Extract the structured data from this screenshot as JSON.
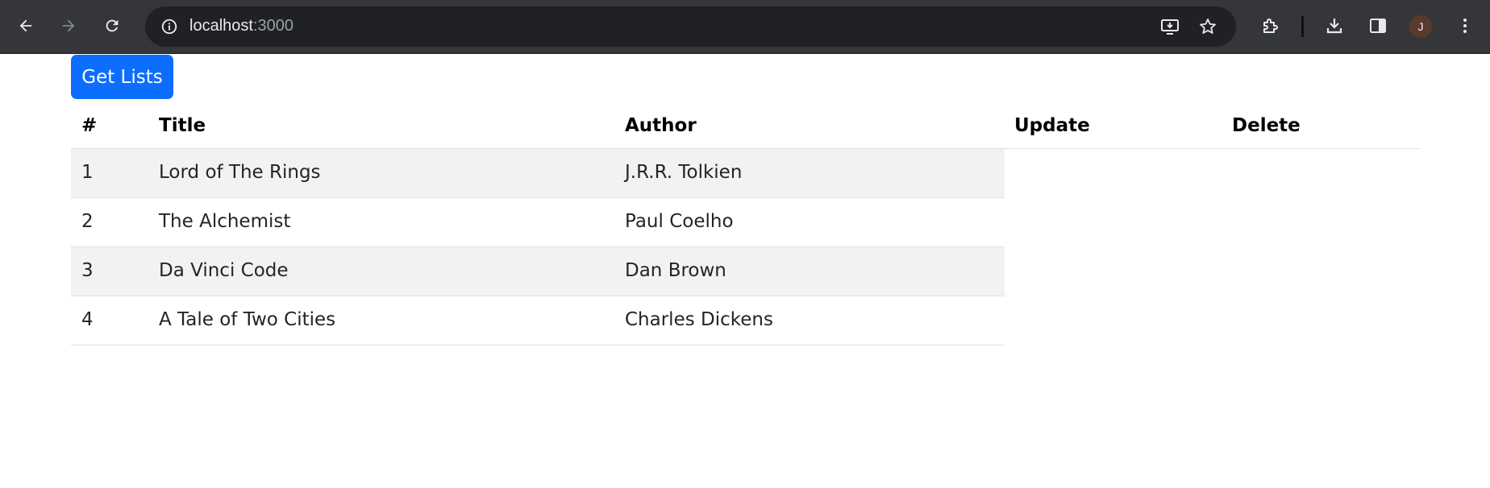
{
  "browser": {
    "url_host": "localhost",
    "url_port": ":3000",
    "avatar_letter": "J",
    "icons": [
      "back-arrow-icon",
      "forward-arrow-icon",
      "reload-icon",
      "site-info-icon",
      "install-app-icon",
      "bookmark-star-icon",
      "extensions-icon",
      "downloads-icon",
      "side-panel-icon",
      "menu-dots-icon"
    ]
  },
  "page": {
    "button_label": "Get Lists",
    "button_color": "#0d6efd",
    "table": {
      "headers": [
        "#",
        "Title",
        "Author",
        "Update",
        "Delete"
      ],
      "rows": [
        {
          "num": "1",
          "title": "Lord of The Rings",
          "author": "J.R.R. Tolkien"
        },
        {
          "num": "2",
          "title": "The Alchemist",
          "author": "Paul Coelho"
        },
        {
          "num": "3",
          "title": "Da Vinci Code",
          "author": "Dan Brown"
        },
        {
          "num": "4",
          "title": "A Tale of Two Cities",
          "author": "Charles Dickens"
        }
      ]
    }
  }
}
